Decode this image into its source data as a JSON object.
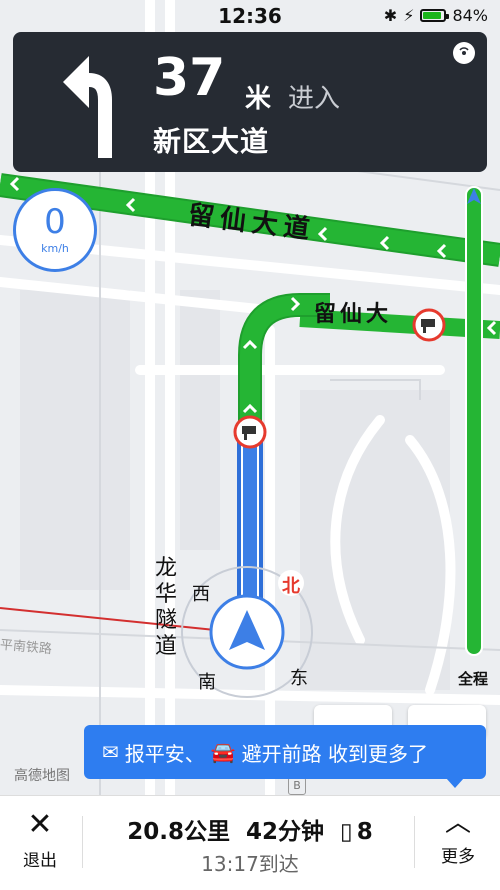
{
  "status_bar": {
    "time": "12:36",
    "battery": "84%",
    "battery_level": 0.84
  },
  "guidance": {
    "distance": "37",
    "unit": "米",
    "action": "进入",
    "road": "新区大道"
  },
  "speed": {
    "value": "0",
    "unit": "km/h"
  },
  "map": {
    "road_main": "留仙大道",
    "road_secondary": "留仙大",
    "tunnel": "龙华隧道",
    "rail": "平南铁路",
    "compass": {
      "north": "北",
      "south": "南",
      "east": "东",
      "west": "西"
    },
    "logo": "高德地图",
    "bmark": "B"
  },
  "progress": {
    "label": "全程"
  },
  "banner": {
    "text1": "报平安、",
    "text2": "避开前路 收到更多了"
  },
  "bottom": {
    "exit": "退出",
    "distance": "20.8公里",
    "duration": "42分钟",
    "lights": "8",
    "arrive": "13:17到达",
    "more": "更多"
  },
  "colors": {
    "route_green": "#25b534",
    "route_blue": "#3d7fe6",
    "guide_bg": "#262b33",
    "banner": "#2e7df0",
    "congestion": "#e63a2e",
    "slow": "#f2c12e"
  }
}
